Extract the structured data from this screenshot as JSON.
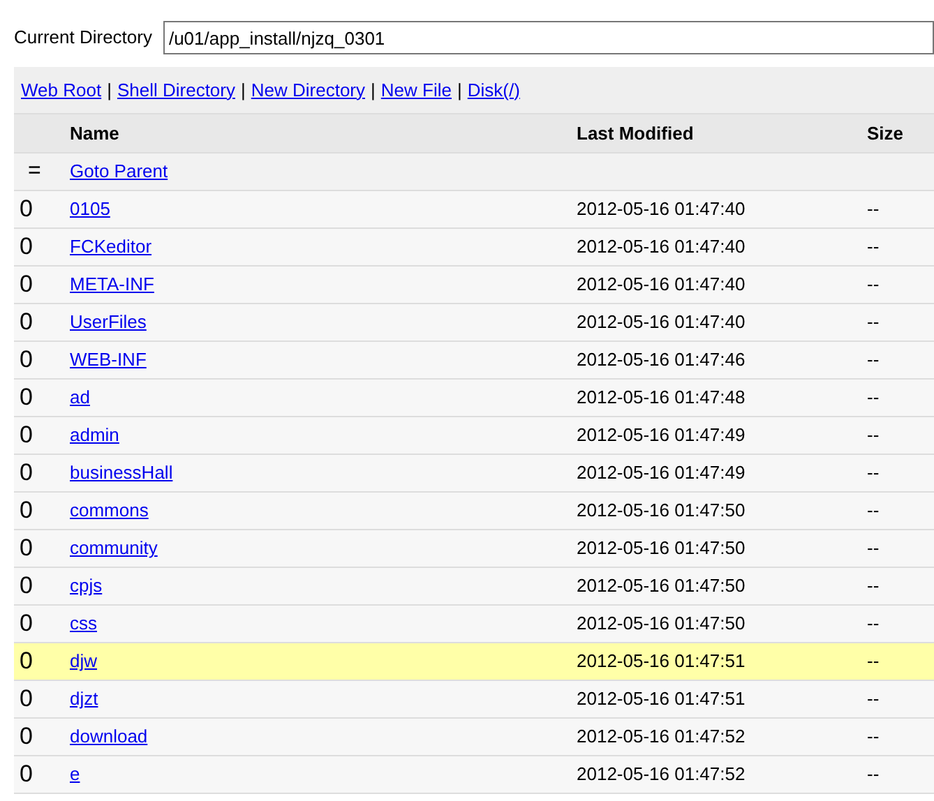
{
  "current_directory": {
    "label": "Current Directory",
    "value": "/u01/app_install/njzq_0301"
  },
  "toolbar_separator": "|",
  "toolbar_links": [
    "Web Root",
    "Shell Directory",
    "New Directory",
    "New File",
    "Disk(/)"
  ],
  "table": {
    "columns": [
      "Name",
      "Last Modified",
      "Size"
    ],
    "parent_row": {
      "icon": "=",
      "label": "Goto Parent"
    },
    "rows": [
      {
        "icon": "0",
        "name": "0105",
        "modified": "2012-05-16 01:47:40",
        "size": "--",
        "selected": false
      },
      {
        "icon": "0",
        "name": "FCKeditor",
        "modified": "2012-05-16 01:47:40",
        "size": "--",
        "selected": false
      },
      {
        "icon": "0",
        "name": "META-INF",
        "modified": "2012-05-16 01:47:40",
        "size": "--",
        "selected": false
      },
      {
        "icon": "0",
        "name": "UserFiles",
        "modified": "2012-05-16 01:47:40",
        "size": "--",
        "selected": false
      },
      {
        "icon": "0",
        "name": "WEB-INF",
        "modified": "2012-05-16 01:47:46",
        "size": "--",
        "selected": false
      },
      {
        "icon": "0",
        "name": "ad",
        "modified": "2012-05-16 01:47:48",
        "size": "--",
        "selected": false
      },
      {
        "icon": "0",
        "name": "admin",
        "modified": "2012-05-16 01:47:49",
        "size": "--",
        "selected": false
      },
      {
        "icon": "0",
        "name": "businessHall",
        "modified": "2012-05-16 01:47:49",
        "size": "--",
        "selected": false
      },
      {
        "icon": "0",
        "name": "commons",
        "modified": "2012-05-16 01:47:50",
        "size": "--",
        "selected": false
      },
      {
        "icon": "0",
        "name": "community",
        "modified": "2012-05-16 01:47:50",
        "size": "--",
        "selected": false
      },
      {
        "icon": "0",
        "name": "cpjs",
        "modified": "2012-05-16 01:47:50",
        "size": "--",
        "selected": false
      },
      {
        "icon": "0",
        "name": "css",
        "modified": "2012-05-16 01:47:50",
        "size": "--",
        "selected": false
      },
      {
        "icon": "0",
        "name": "djw",
        "modified": "2012-05-16 01:47:51",
        "size": "--",
        "selected": true
      },
      {
        "icon": "0",
        "name": "djzt",
        "modified": "2012-05-16 01:47:51",
        "size": "--",
        "selected": false
      },
      {
        "icon": "0",
        "name": "download",
        "modified": "2012-05-16 01:47:52",
        "size": "--",
        "selected": false
      },
      {
        "icon": "0",
        "name": "e",
        "modified": "2012-05-16 01:47:52",
        "size": "--",
        "selected": false
      }
    ]
  }
}
